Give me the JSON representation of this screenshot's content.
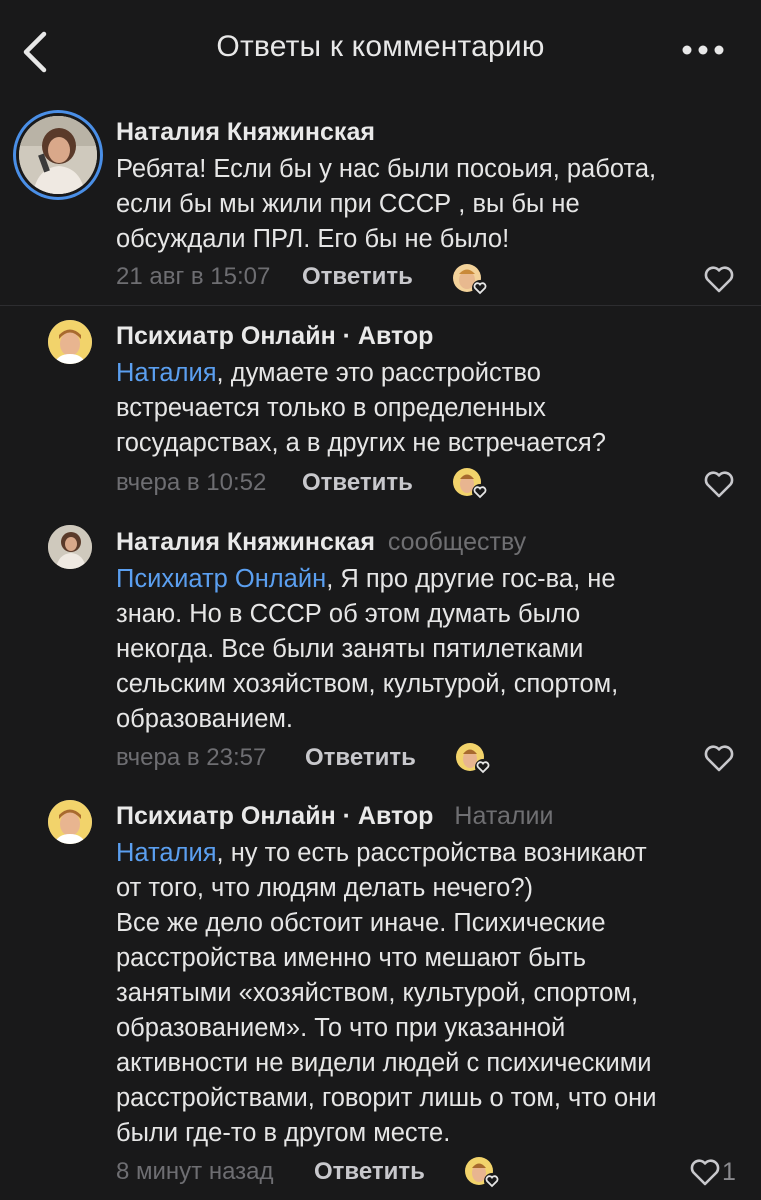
{
  "header": {
    "title": "Ответы к комментарию",
    "back_icon": "chevron-left-icon",
    "more_icon": "more-horizontal-icon"
  },
  "colors": {
    "background": "#19191a",
    "mention": "#5b9ff0",
    "secondary": "#6e6e72",
    "avatar_ring": "#4a8fe7"
  },
  "comments": [
    {
      "author": "Наталия Княжинская",
      "author_suffix": "",
      "addressee": "",
      "mention": "",
      "text_lines": [
        "Ребята! Если бы   у нас были посоьия, работа,",
        "если бы мы жили при СССР , вы бы не",
        "обсуждали ПРЛ. Его бы не было!"
      ],
      "time": "21 авг в 15:07",
      "reply_label": "Ответить",
      "likes": ""
    },
    {
      "author": "Психиатр Онлайн",
      "author_suffix": " · Автор",
      "addressee": "",
      "mention": "Наталия",
      "text_lines": [
        ", думаете это расстройство",
        "встречается только в определенных",
        "государствах, а в других не встречается?"
      ],
      "time": "вчера в 10:52",
      "reply_label": "Ответить",
      "likes": ""
    },
    {
      "author": "Наталия Княжинская",
      "author_suffix": "",
      "addressee": "сообществу",
      "mention": "Психиатр Онлайн",
      "text_lines": [
        ", Я про другие гос-ва, не",
        "знаю.  Но в СССР об этом думать было",
        "некогда. Все были заняты пятилетками",
        "сельским хозяйством, культурой, спортом,",
        "образованием."
      ],
      "time": "вчера в 23:57",
      "reply_label": "Ответить",
      "likes": ""
    },
    {
      "author": "Психиатр Онлайн",
      "author_suffix": " · Автор",
      "addressee": "Наталии",
      "mention": "Наталия",
      "text_lines": [
        ", ну то есть расстройства возникают",
        "от того, что людям делать нечего?)",
        "Все же дело обстоит иначе. Психические",
        "расстройства именно что мешают быть",
        "занятыми «хозяйством, культурой, спортом,",
        "образованием». То что при указанной",
        "активности не видели людей с психическими",
        "расстройствами, говорит лишь о том, что они",
        "были где-то в другом месте."
      ],
      "time": "8 минут назад",
      "reply_label": "Ответить",
      "likes": "1"
    }
  ]
}
